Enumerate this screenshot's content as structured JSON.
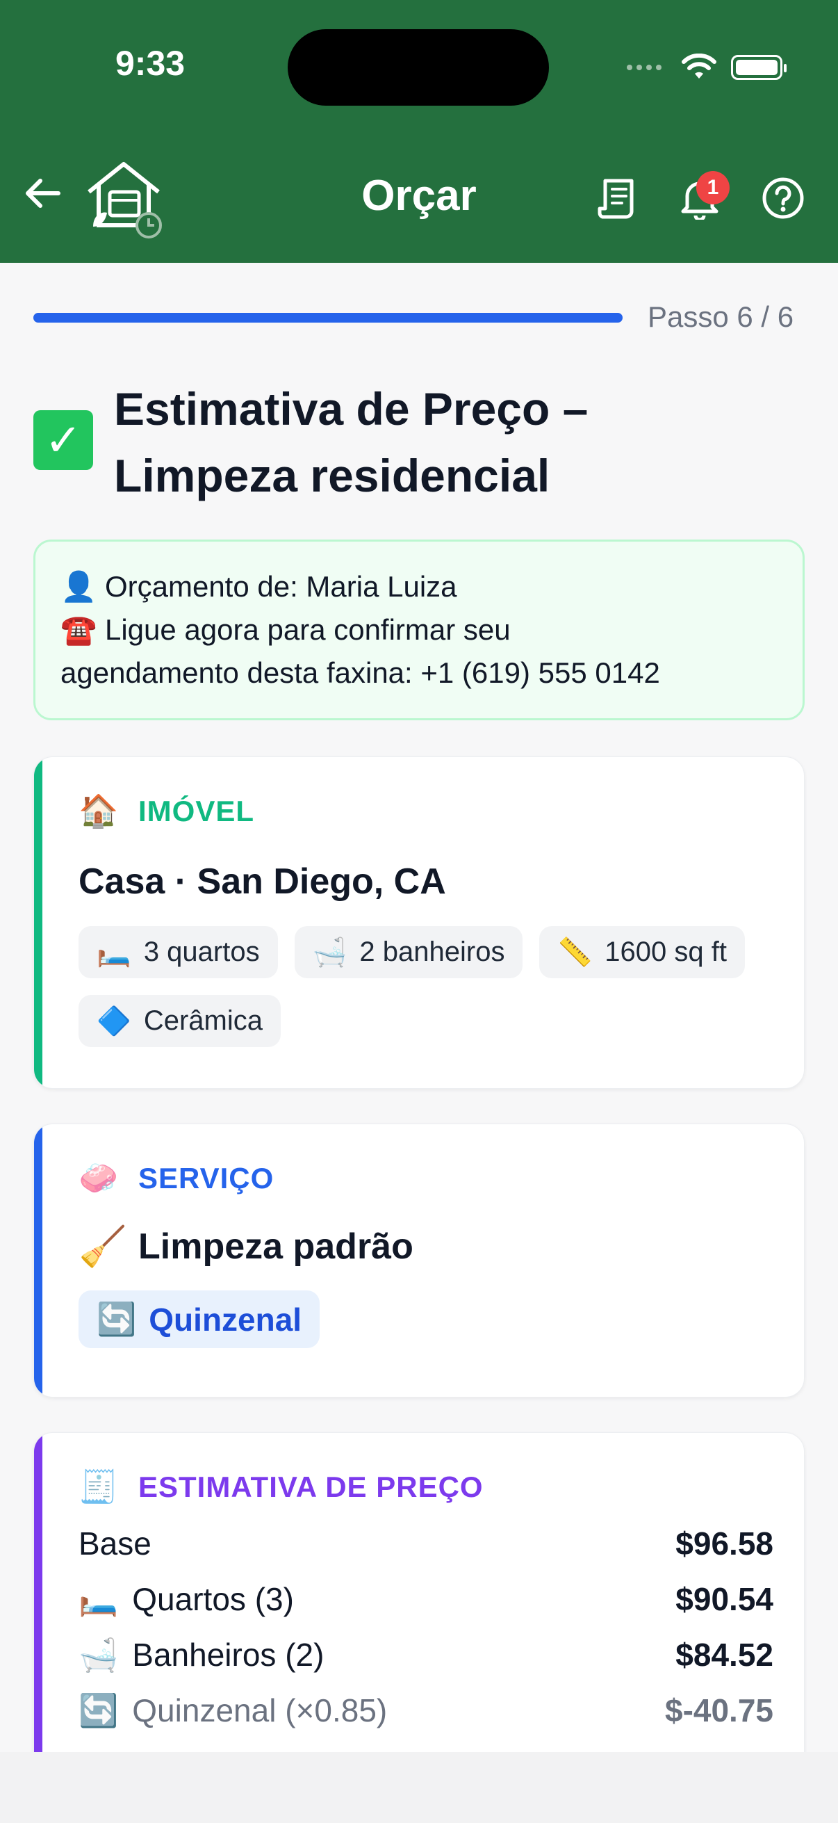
{
  "status": {
    "time": "9:33"
  },
  "header": {
    "title": "Orçar",
    "notification_count": "1"
  },
  "progress": {
    "fraction": 1.0,
    "step_label": "Passo 6 / 6"
  },
  "page": {
    "title_line1": "Estimativa de Preço –",
    "title_line2": "Limpeza residencial"
  },
  "contact": {
    "line1": "👤 Orçamento de: Maria Luiza",
    "line2": "☎️ Ligue agora para confirmar seu",
    "line3": "agendamento desta faxina: +1 (619) 555 0142"
  },
  "property": {
    "heading": "IMÓVEL",
    "summary": "Casa · San Diego, CA",
    "chips": [
      "3 quartos",
      "2 banheiros",
      "1600 sq ft",
      "Cerâmica"
    ],
    "accent": "#10b981"
  },
  "service": {
    "heading": "SERVIÇO",
    "name": "Limpeza padrão",
    "frequency": "Quinzenal",
    "accent": "#2563eb"
  },
  "estimate": {
    "heading": "ESTIMATIVA DE PREÇO",
    "accent": "#7c3aed",
    "rows": [
      {
        "label": "Base",
        "amount": "$96.58"
      },
      {
        "label": "Quartos (3)",
        "amount": "$90.54"
      },
      {
        "label": "Banheiros (2)",
        "amount": "$84.52"
      },
      {
        "label": "Quinzenal (×0.85)",
        "amount": "$-40.75"
      }
    ]
  },
  "colors": {
    "header_bg": "#24703e",
    "progress": "#2563eb"
  }
}
